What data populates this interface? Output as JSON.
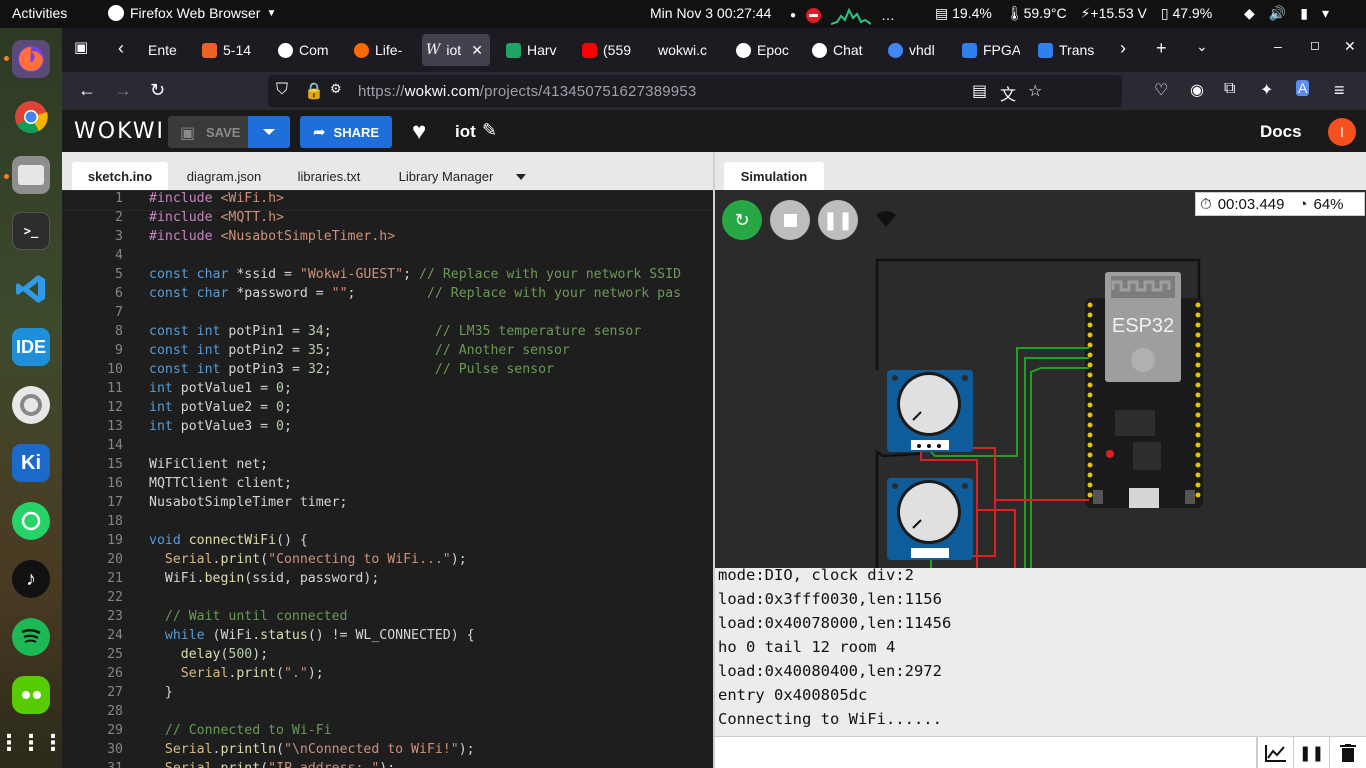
{
  "os": {
    "activities": "Activities",
    "app_name": "Firefox Web Browser",
    "clock": "Min Nov 3  00:27:44",
    "tray_more": "…",
    "cpu": "19.4%",
    "temp": "59.9°C",
    "power": "+15.53 V",
    "battery": "47.9%"
  },
  "dock": {
    "items": [
      "firefox",
      "chrome",
      "files",
      "terminal",
      "vscode",
      "ide",
      "settings",
      "ki",
      "whatsapp",
      "tiktok",
      "spotify",
      "duolingo",
      "app-grid"
    ],
    "ide_label": "IDE",
    "ki_label": "Ki"
  },
  "browser": {
    "tabs": [
      {
        "label": "Ente",
        "color": "#555"
      },
      {
        "label": "5-14",
        "color": "#e8632a"
      },
      {
        "label": "Com",
        "color": "#fff"
      },
      {
        "label": "Life-",
        "color": "#ff6a00"
      },
      {
        "label": "iot",
        "color": "#ddd"
      },
      {
        "label": "Harv",
        "color": "#1fa463"
      },
      {
        "label": "(559",
        "color": "#ff0000"
      },
      {
        "label": "wokwi.c",
        "color": "#1c1b22"
      },
      {
        "label": "Epoc",
        "color": "#fff"
      },
      {
        "label": "Chat",
        "color": "#fff"
      },
      {
        "label": "vhdl",
        "color": "#4285f4"
      },
      {
        "label": "FPGA",
        "color": "#2f80ed"
      },
      {
        "label": "Trans",
        "color": "#2f80ed"
      }
    ],
    "url_prefix": "https://",
    "url_host": "wokwi.com",
    "url_path": "/projects/413450751627389953"
  },
  "wokwi": {
    "logo": "WOKWI",
    "save_label": "SAVE",
    "share_label": "SHARE",
    "project_name": "iot",
    "docs_label": "Docs",
    "avatar_letter": "I",
    "editor_tabs": [
      "sketch.ino",
      "diagram.json",
      "libraries.txt",
      "Library Manager"
    ],
    "sim_tab": "Simulation",
    "timer": "00:03.449",
    "speed": "64%",
    "esp_label": "ESP32"
  },
  "code_lines": [
    "#include <WiFi.h>",
    "#include <MQTT.h>",
    "#include <NusabotSimpleTimer.h>",
    "",
    "const char *ssid = \"Wokwi-GUEST\"; // Replace with your network SSID",
    "const char *password = \"\";         // Replace with your network pas",
    "",
    "const int potPin1 = 34;             // LM35 temperature sensor",
    "const int potPin2 = 35;             // Another sensor",
    "const int potPin3 = 32;             // Pulse sensor",
    "int potValue1 = 0;",
    "int potValue2 = 0;",
    "int potValue3 = 0;",
    "",
    "WiFiClient net;",
    "MQTTClient client;",
    "NusabotSimpleTimer timer;",
    "",
    "void connectWiFi() {",
    "  Serial.print(\"Connecting to WiFi...\");",
    "  WiFi.begin(ssid, password);",
    "",
    "  // Wait until connected",
    "  while (WiFi.status() != WL_CONNECTED) {",
    "    delay(500);",
    "    Serial.print(\".\");",
    "  }",
    "",
    "  // Connected to Wi-Fi",
    "  Serial.println(\"\\nConnected to WiFi!\");",
    "  Serial.print(\"IP address: \");"
  ],
  "serial_lines": [
    "mode:DIO, clock div:2",
    "load:0x3fff0030,len:1156",
    "load:0x40078000,len:11456",
    "ho 0 tail 12 room 4",
    "load:0x40080400,len:2972",
    "entry 0x400805dc",
    "Connecting to WiFi......"
  ],
  "colors": {
    "wokwi_blue": "#1e6fd9",
    "sim_green": "#28a745",
    "pcb_blue": "#0f5c9a",
    "wire_red": "#e02020",
    "wire_green": "#22a020"
  }
}
